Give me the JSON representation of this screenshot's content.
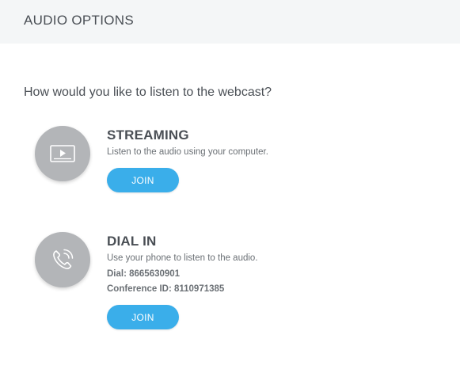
{
  "header": {
    "title": "AUDIO OPTIONS"
  },
  "question": "How would you like to listen to the webcast?",
  "options": [
    {
      "icon": "video-screen-icon",
      "title": "STREAMING",
      "description": "Listen to the audio using your computer.",
      "join_label": "JOIN"
    },
    {
      "icon": "phone-icon",
      "title": "DIAL IN",
      "description": "Use your phone to listen to the audio.",
      "dial": "Dial: 8665630901",
      "conference": "Conference ID: 8110971385",
      "join_label": "JOIN"
    }
  ],
  "colors": {
    "header_bg": "#f4f6f7",
    "icon_circle": "#b3b5b8",
    "button": "#3aaeea",
    "text": "#4a4f55"
  }
}
